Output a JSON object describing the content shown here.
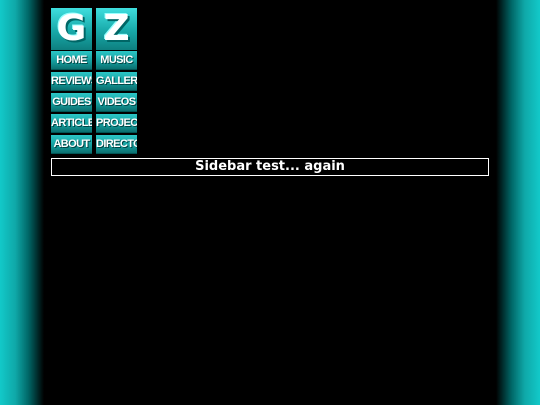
{
  "logo": {
    "letters": [
      "G",
      "Z"
    ]
  },
  "nav": {
    "items": [
      "HOME",
      "MUSIC",
      "REVIEWS",
      "GALLERY",
      "GUIDES",
      "VIDEOS",
      "ARTICLES",
      "PROJECTS",
      "ABOUT",
      "DIRECTORY"
    ]
  },
  "main": {
    "title": "Sidebar test... again"
  },
  "colors": {
    "background": "#000000",
    "accent": "#12c9c9",
    "text": "#ffffff"
  }
}
